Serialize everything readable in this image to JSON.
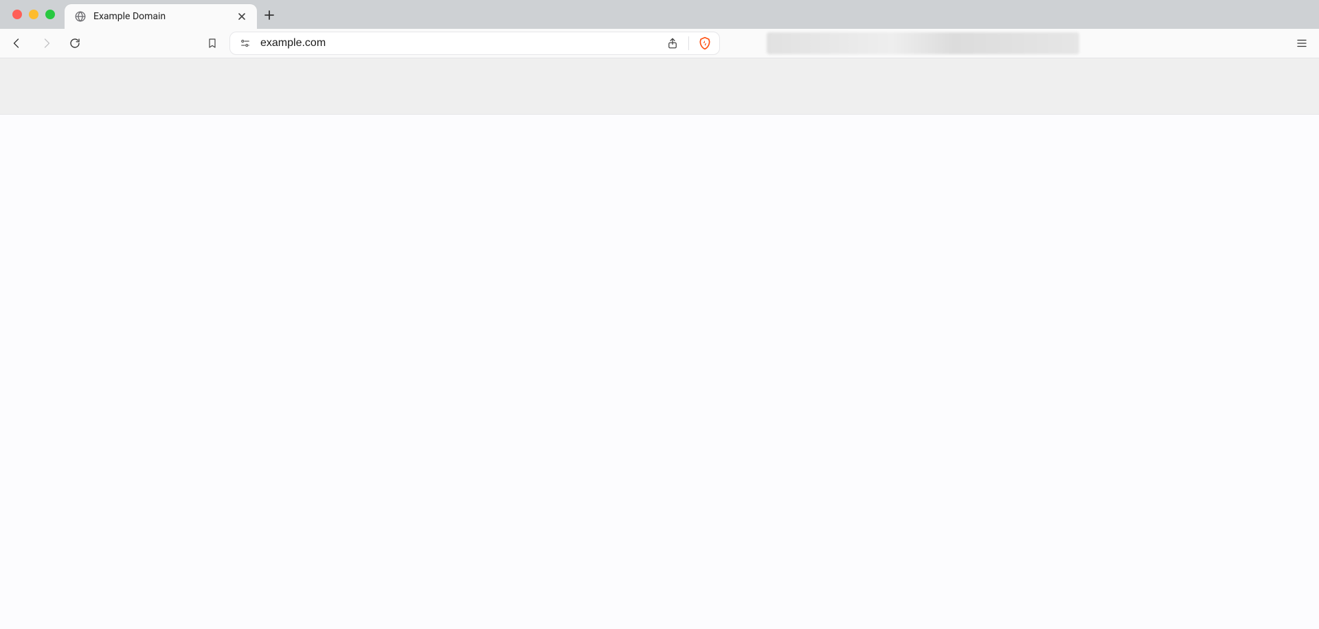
{
  "tabs": [
    {
      "title": "Example Domain"
    }
  ],
  "address_bar": {
    "url": "example.com"
  },
  "colors": {
    "tab_strip": "#ced1d4",
    "toolbar": "#fafafa",
    "secondary_bar": "#efefef",
    "brave_orange": "#ff4f10"
  }
}
